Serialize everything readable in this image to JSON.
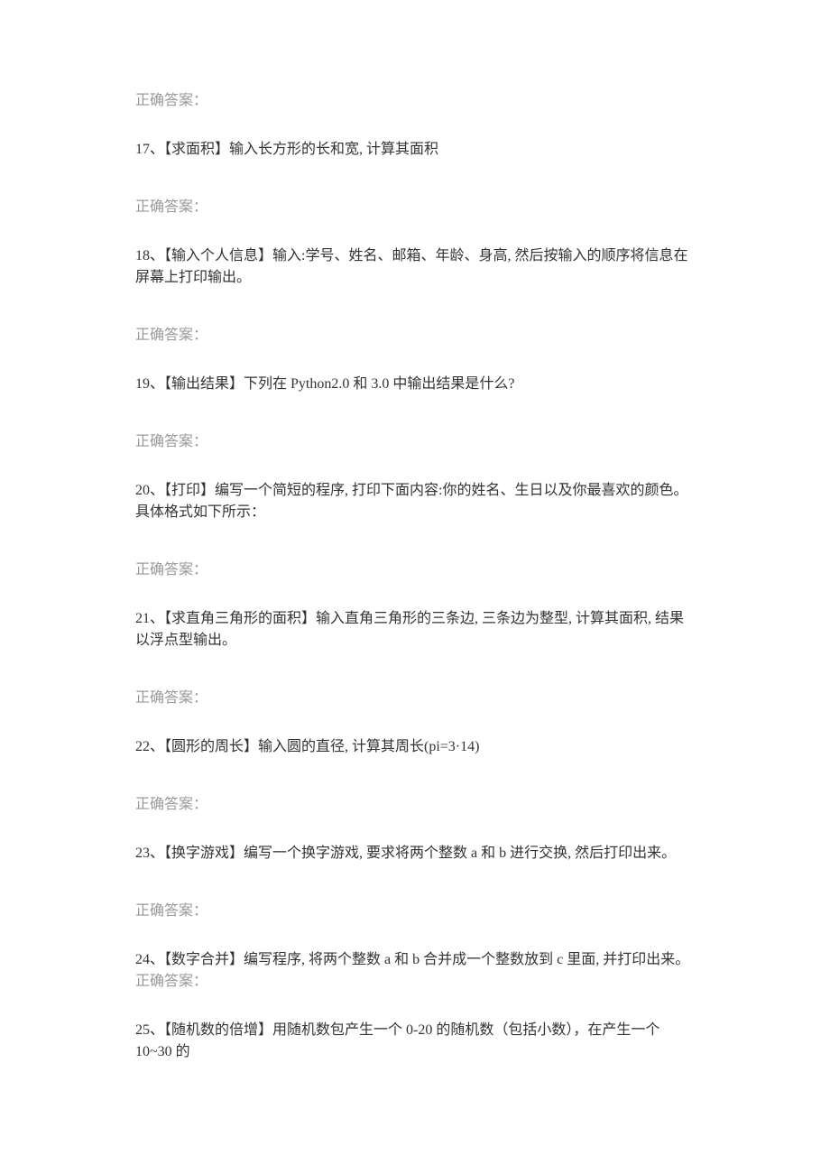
{
  "labels": {
    "correct_answer": "正确答案："
  },
  "questions": {
    "q17": "17、【求面积】输入长方形的长和宽, 计算其面积",
    "q18": "18、【输入个人信息】输入:学号、姓名、邮箱、年龄、身高, 然后按输入的顺序将信息在屏幕上打印输出。",
    "q19": "19、【输出结果】下列在 Python2.0 和 3.0 中输出结果是什么?",
    "q20": "20、【打印】编写一个简短的程序, 打印下面内容:你的姓名、生日以及你最喜欢的颜色。具体格式如下所示：",
    "q21": "21、【求直角三角形的面积】输入直角三角形的三条边, 三条边为整型, 计算其面积, 结果以浮点型输出。",
    "q22": "22、【圆形的周长】输入圆的直径, 计算其周长(pi=3·14)",
    "q23": "23、【换字游戏】编写一个换字游戏, 要求将两个整数 a 和 b 进行交换, 然后打印出来。",
    "q24": "24、【数字合并】编写程序, 将两个整数 a 和 b 合并成一个整数放到 c 里面, 并打印出来。",
    "q25": "25、【随机数的倍增】用随机数包产生一个 0-20 的随机数（包括小数），在产生一个 10~30 的"
  }
}
